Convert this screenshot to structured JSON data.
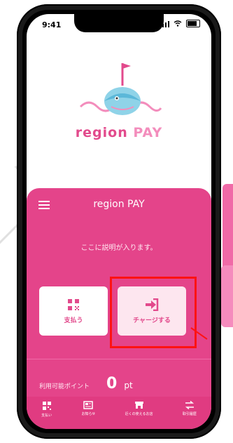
{
  "status_bar": {
    "time": "9:41"
  },
  "logo": {
    "brand_text_1": "region",
    "brand_text_2": "PAY"
  },
  "panel": {
    "title": "region PAY",
    "description": "ここに説明が入ります。",
    "actions": [
      {
        "label": "支払う"
      },
      {
        "label": "チャージする"
      }
    ],
    "points": {
      "label": "利用可能ポイント",
      "value": "0",
      "unit": "pt"
    }
  },
  "bottom_nav": [
    {
      "label": "支払い"
    },
    {
      "label": "お知らせ"
    },
    {
      "label": "近くの使えるお店"
    },
    {
      "label": "取引履歴"
    }
  ],
  "colors": {
    "accent": "#e4448a",
    "highlight": "#ff1212"
  }
}
